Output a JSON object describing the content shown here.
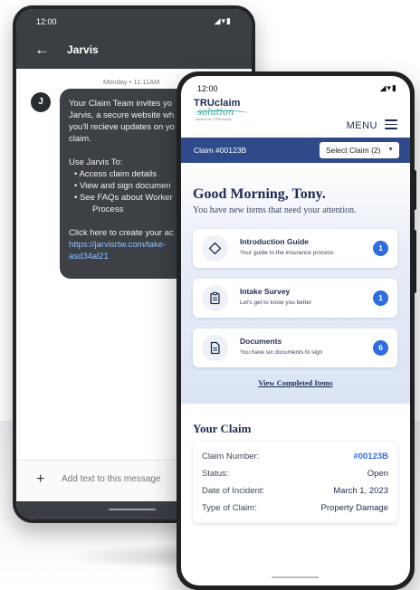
{
  "messages_app": {
    "status_time": "12:00",
    "title": "Jarvis",
    "date_label": "Monday • 11:11AM",
    "avatar_initial": "J",
    "bubble": {
      "para1": [
        "Your Claim Team invites yo",
        "Jarvis, a secure website wh",
        "you'll recieve updates on yo",
        "claim."
      ],
      "use_label": "Use Jarvis To:",
      "bullets": [
        "•  Access claim details",
        "•  View and sign documen",
        "•  See FAQs about Worker"
      ],
      "bullet_cont": "Process",
      "cta": "Click here to create your ac",
      "link_lines": [
        "https://jarvisrtw.com/take-",
        "asd34al21"
      ]
    },
    "input_placeholder": "Add text to this message"
  },
  "claim_app": {
    "status_time": "12:00",
    "logo": {
      "brand": "TRUclaim",
      "script": "solution",
      "tagline": "powered by TTRA Mutual"
    },
    "menu_label": "MENU",
    "claim_label": "Claim #00123B",
    "claim_select": "Select Claim (2)",
    "greeting": "Good Morning, Tony.",
    "greeting_sub": "You have new items that need your attention.",
    "tasks": [
      {
        "title": "Introduction Guide",
        "subtitle": "Your guide to the insurance process",
        "badge": "1",
        "icon": "diamond-icon"
      },
      {
        "title": "Intake Survey",
        "subtitle": "Let's get to know you better",
        "badge": "1",
        "icon": "clipboard-icon"
      },
      {
        "title": "Documents",
        "subtitle": "You have six documents to sign",
        "badge": "6",
        "icon": "document-icon"
      }
    ],
    "view_completed": "View Completed Items",
    "your_claim": {
      "title": "Your Claim",
      "rows": [
        {
          "label": "Claim Number:",
          "value": "#00123B"
        },
        {
          "label": "Status:",
          "value": "Open"
        },
        {
          "label": "Date of Incident:",
          "value": "March 1, 2023"
        },
        {
          "label": "Type of Claim:",
          "value": "Property Damage"
        }
      ]
    },
    "colors": {
      "navy": "#1d2b4f",
      "claim_bar": "#2f4a8a",
      "badge_blue": "#2f6ee0",
      "logo_teal": "#3aa6a0"
    }
  }
}
